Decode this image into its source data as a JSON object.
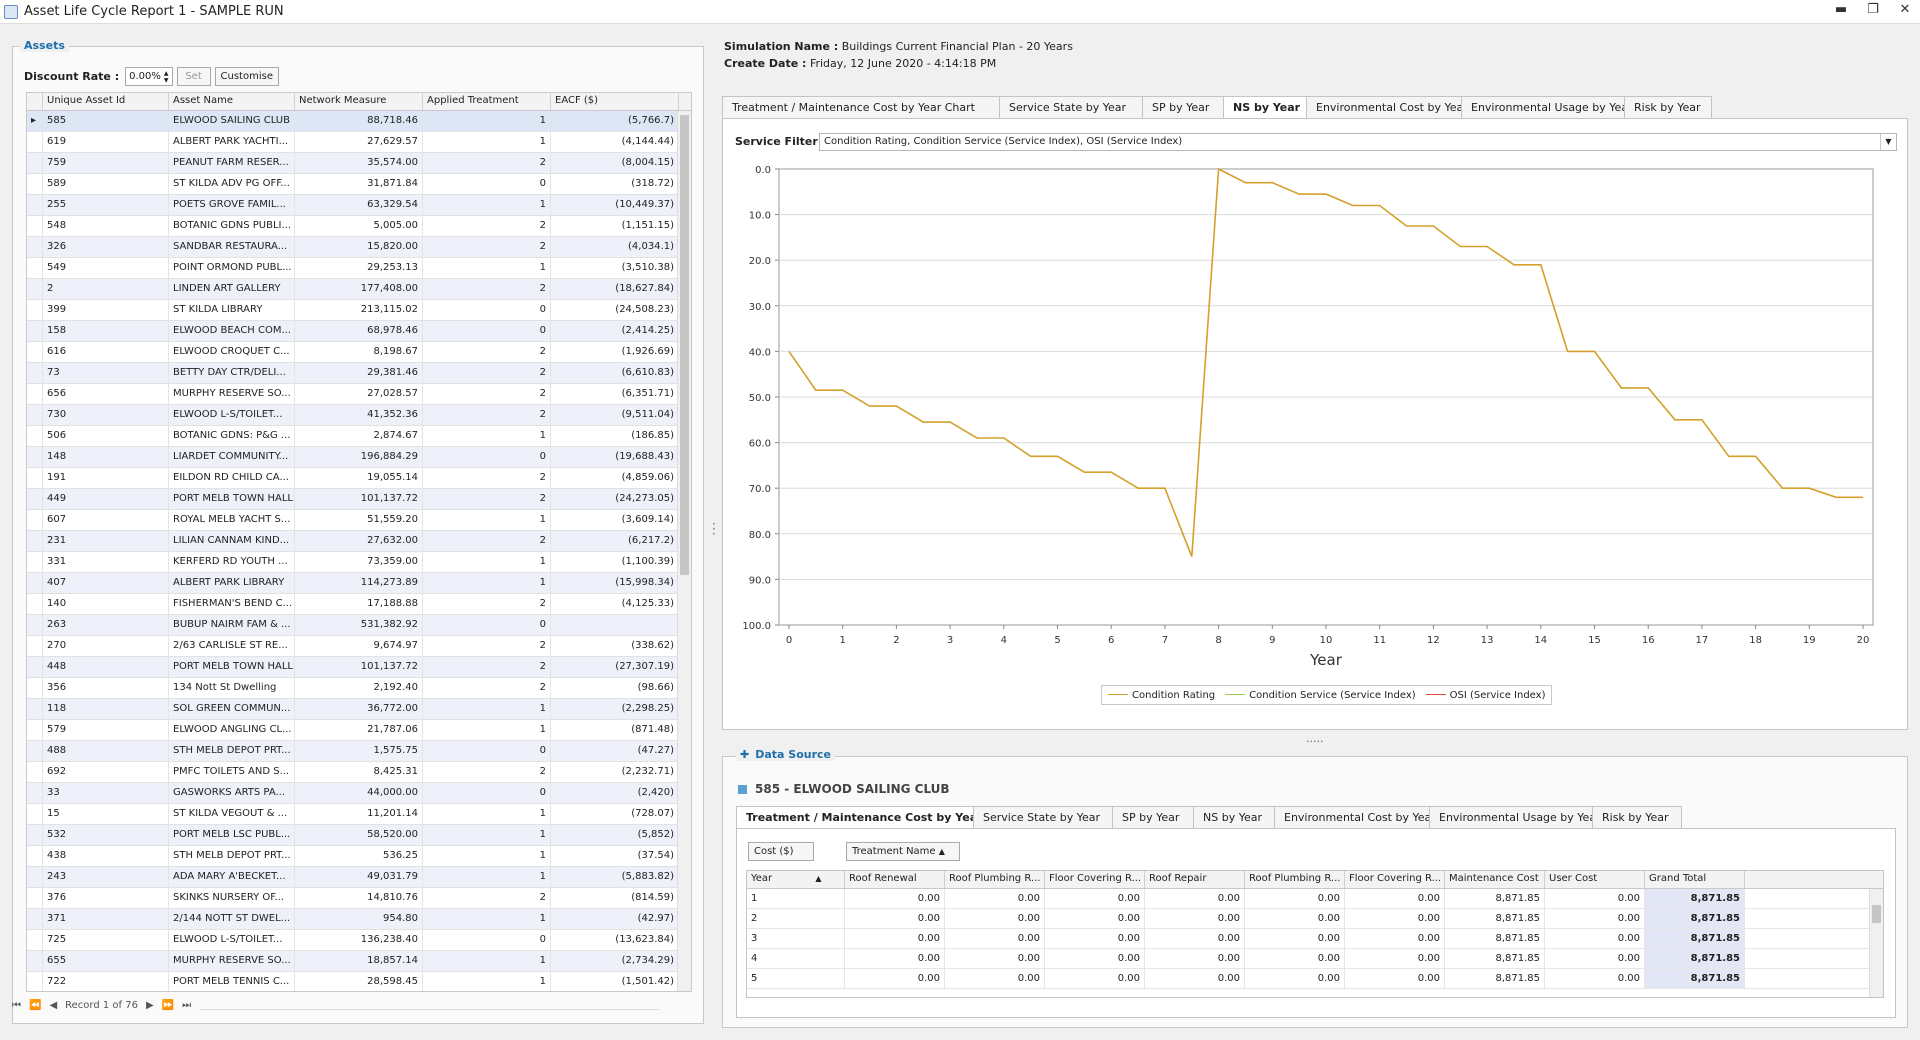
{
  "window": {
    "title": "Asset Life Cycle Report 1 - SAMPLE RUN",
    "minimize": "▬",
    "restore": "❐",
    "close": "✕"
  },
  "assets": {
    "group_title": "Assets",
    "discount_label": "Discount Rate :",
    "discount_value": "0.00%",
    "set_label": "Set",
    "customise_label": "Customise",
    "columns": [
      "Unique Asset Id",
      "Asset Name",
      "Network Measure",
      "Applied Treatment",
      "EACF ($)"
    ],
    "rows": [
      [
        "585",
        "ELWOOD SAILING CLUB",
        "88,718.46",
        "1",
        "(5,766.7)"
      ],
      [
        "619",
        "ALBERT PARK YACHTI...",
        "27,629.57",
        "1",
        "(4,144.44)"
      ],
      [
        "759",
        "PEANUT FARM RESER...",
        "35,574.00",
        "2",
        "(8,004.15)"
      ],
      [
        "589",
        "ST KILDA ADV PG OFF...",
        "31,871.84",
        "0",
        "(318.72)"
      ],
      [
        "255",
        "POETS GROVE FAMIL...",
        "63,329.54",
        "1",
        "(10,449.37)"
      ],
      [
        "548",
        "BOTANIC GDNS PUBLI...",
        "5,005.00",
        "2",
        "(1,151.15)"
      ],
      [
        "326",
        "SANDBAR RESTAURA...",
        "15,820.00",
        "2",
        "(4,034.1)"
      ],
      [
        "549",
        "POINT ORMOND PUBL...",
        "29,253.13",
        "1",
        "(3,510.38)"
      ],
      [
        "2",
        "LINDEN ART GALLERY",
        "177,408.00",
        "2",
        "(18,627.84)"
      ],
      [
        "399",
        "ST KILDA LIBRARY",
        "213,115.02",
        "0",
        "(24,508.23)"
      ],
      [
        "158",
        "ELWOOD BEACH COM...",
        "68,978.46",
        "0",
        "(2,414.25)"
      ],
      [
        "616",
        "ELWOOD CROQUET C...",
        "8,198.67",
        "2",
        "(1,926.69)"
      ],
      [
        "73",
        "BETTY DAY CTR/DELI...",
        "29,381.46",
        "2",
        "(6,610.83)"
      ],
      [
        "656",
        "MURPHY RESERVE SO...",
        "27,028.57",
        "2",
        "(6,351.71)"
      ],
      [
        "730",
        "ELWOOD L-S/TOILET...",
        "41,352.36",
        "2",
        "(9,511.04)"
      ],
      [
        "506",
        "BOTANIC GDNS: P&G ...",
        "2,874.67",
        "1",
        "(186.85)"
      ],
      [
        "148",
        "LIARDET COMMUNITY...",
        "196,884.29",
        "0",
        "(19,688.43)"
      ],
      [
        "191",
        "EILDON RD CHILD CA...",
        "19,055.14",
        "2",
        "(4,859.06)"
      ],
      [
        "449",
        "PORT MELB TOWN HALL",
        "101,137.72",
        "2",
        "(24,273.05)"
      ],
      [
        "607",
        "ROYAL MELB YACHT S...",
        "51,559.20",
        "1",
        "(3,609.14)"
      ],
      [
        "231",
        "LILIAN CANNAM KIND...",
        "27,632.00",
        "2",
        "(6,217.2)"
      ],
      [
        "331",
        "KERFERD RD YOUTH ...",
        "73,359.00",
        "1",
        "(1,100.39)"
      ],
      [
        "407",
        "ALBERT PARK LIBRARY",
        "114,273.89",
        "1",
        "(15,998.34)"
      ],
      [
        "140",
        "FISHERMAN'S BEND C...",
        "17,188.88",
        "2",
        "(4,125.33)"
      ],
      [
        "263",
        "BUBUP NAIRM FAM & ...",
        "531,382.92",
        "0",
        ""
      ],
      [
        "270",
        "2/63 CARLISLE ST RE...",
        "9,674.97",
        "2",
        "(338.62)"
      ],
      [
        "448",
        "PORT MELB TOWN HALL",
        "101,137.72",
        "2",
        "(27,307.19)"
      ],
      [
        "356",
        "134 Nott St Dwelling",
        "2,192.40",
        "2",
        "(98.66)"
      ],
      [
        "118",
        "SOL GREEN COMMUN...",
        "36,772.00",
        "1",
        "(2,298.25)"
      ],
      [
        "579",
        "ELWOOD ANGLING CL...",
        "21,787.06",
        "1",
        "(871.48)"
      ],
      [
        "488",
        "STH MELB DEPOT PRT...",
        "1,575.75",
        "0",
        "(47.27)"
      ],
      [
        "692",
        "PMFC TOILETS AND S...",
        "8,425.31",
        "2",
        "(2,232.71)"
      ],
      [
        "33",
        "GASWORKS ARTS PA...",
        "44,000.00",
        "0",
        "(2,420)"
      ],
      [
        "15",
        "ST KILDA VEGOUT & ...",
        "11,201.14",
        "1",
        "(728.07)"
      ],
      [
        "532",
        "PORT MELB LSC PUBL...",
        "58,520.00",
        "1",
        "(5,852)"
      ],
      [
        "438",
        "STH MELB DEPOT PRT...",
        "536.25",
        "1",
        "(37.54)"
      ],
      [
        "243",
        "ADA MARY A'BECKET...",
        "49,031.79",
        "1",
        "(5,883.82)"
      ],
      [
        "376",
        "SKINKS NURSERY OF...",
        "14,810.76",
        "2",
        "(814.59)"
      ],
      [
        "371",
        "2/144 NOTT ST DWEL...",
        "954.80",
        "1",
        "(42.97)"
      ],
      [
        "725",
        "ELWOOD L-S/TOILET...",
        "136,238.40",
        "0",
        "(13,623.84)"
      ],
      [
        "655",
        "MURPHY RESERVE SO...",
        "18,857.14",
        "1",
        "(2,734.29)"
      ],
      [
        "722",
        "PORT MELB TENNIS C...",
        "28,598.45",
        "1",
        "(1,501.42)"
      ]
    ],
    "record_label": "Record 1 of 76"
  },
  "simulation": {
    "name_label": "Simulation Name :",
    "name_value": "Buildings Current Financial Plan - 20 Years",
    "date_label": "Create Date :",
    "date_value": "Friday, 12 June 2020 - 4:14:18 PM"
  },
  "chart_tabs": [
    "Treatment / Maintenance Cost by Year Chart",
    "Service State by Year",
    "SP by Year",
    "NS by Year",
    "Environmental Cost by Year",
    "Environmental Usage by Year",
    "Risk by Year"
  ],
  "chart_active_tab": "NS by Year",
  "service_filter": {
    "label": "Service Filter :",
    "value": "Condition Rating, Condition Service (Service Index), OSI (Service Index)"
  },
  "colors": {
    "condition_rating": "#d4a02a",
    "condition_service": "#9ac64a",
    "osi": "#e0533a",
    "accent": "#1e6fa8"
  },
  "chart_data": {
    "type": "line",
    "xlabel": "Year",
    "ylabel": "",
    "ylim": [
      100,
      0
    ],
    "y_inverted": true,
    "x_ticks": [
      "0",
      "1",
      "2",
      "3",
      "4",
      "5",
      "6",
      "7",
      "8",
      "9",
      "10",
      "11",
      "12",
      "13",
      "14",
      "15",
      "16",
      "17",
      "18",
      "19",
      "20"
    ],
    "y_ticks": [
      "0.0",
      "10.0",
      "20.0",
      "30.0",
      "40.0",
      "50.0",
      "60.0",
      "70.0",
      "80.0",
      "90.0",
      "100.0"
    ],
    "grid": true,
    "legend": "bottom",
    "series": [
      {
        "name": "Condition Rating",
        "x": [
          0,
          0.5,
          1,
          1.5,
          2,
          2.5,
          3,
          3.5,
          4,
          4.5,
          5,
          5.5,
          6,
          6.5,
          7,
          7.5,
          8,
          8.5,
          9,
          9.5,
          10,
          10.5,
          11,
          11.5,
          12,
          12.5,
          13,
          13.5,
          14,
          14.5,
          15,
          15.5,
          16,
          16.5,
          17,
          17.5,
          18,
          18.5,
          19,
          19.5,
          20
        ],
        "y": [
          40,
          48.5,
          48.5,
          52,
          52,
          55.5,
          55.5,
          59,
          59,
          63,
          63,
          66.5,
          66.5,
          70,
          70,
          85,
          0,
          3,
          3,
          5.5,
          5.5,
          8,
          8,
          12.5,
          12.5,
          17,
          17,
          21,
          21,
          40,
          40,
          48,
          48,
          55,
          55,
          63,
          63,
          70,
          70,
          72,
          72
        ]
      },
      {
        "name": "Condition Service (Service Index)",
        "x": [],
        "y": []
      },
      {
        "name": "OSI (Service Index)",
        "x": [],
        "y": []
      }
    ]
  },
  "data_source": {
    "title": "Data Source",
    "asset_heading": "585 - ELWOOD SAILING CLUB",
    "tabs": [
      "Treatment / Maintenance Cost by Year",
      "Service State by Year",
      "SP by Year",
      "NS by Year",
      "Environmental Cost by Year",
      "Environmental Usage by Year",
      "Risk by Year"
    ],
    "active_tab": "Treatment / Maintenance Cost by Year",
    "cost_chip": "Cost ($)",
    "treatment_chip": "Treatment Name",
    "columns": [
      "Year",
      "Roof Renewal",
      "Roof Plumbing R...",
      "Floor Covering R...",
      "Roof Repair",
      "Roof Plumbing R...",
      "Floor Covering R...",
      "Maintenance Cost",
      "User Cost",
      "Grand Total"
    ],
    "rows": [
      [
        "1",
        "0.00",
        "0.00",
        "0.00",
        "0.00",
        "0.00",
        "0.00",
        "8,871.85",
        "0.00",
        "8,871.85"
      ],
      [
        "2",
        "0.00",
        "0.00",
        "0.00",
        "0.00",
        "0.00",
        "0.00",
        "8,871.85",
        "0.00",
        "8,871.85"
      ],
      [
        "3",
        "0.00",
        "0.00",
        "0.00",
        "0.00",
        "0.00",
        "0.00",
        "8,871.85",
        "0.00",
        "8,871.85"
      ],
      [
        "4",
        "0.00",
        "0.00",
        "0.00",
        "0.00",
        "0.00",
        "0.00",
        "8,871.85",
        "0.00",
        "8,871.85"
      ],
      [
        "5",
        "0.00",
        "0.00",
        "0.00",
        "0.00",
        "0.00",
        "0.00",
        "8,871.85",
        "0.00",
        "8,871.85"
      ]
    ]
  }
}
